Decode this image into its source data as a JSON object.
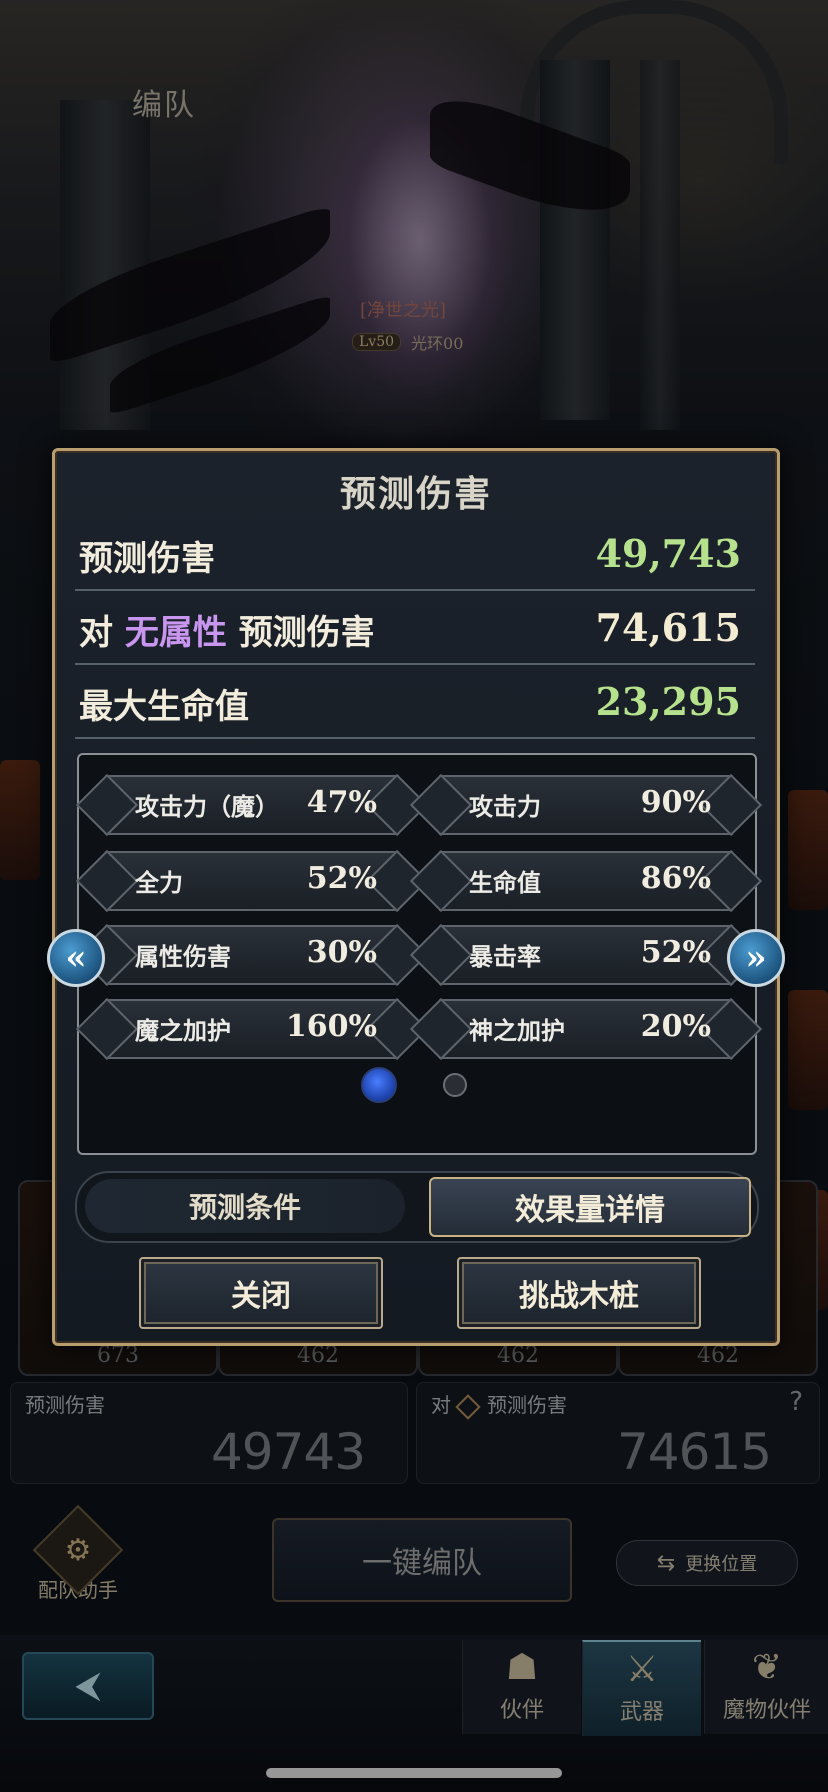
{
  "background": {
    "screen_title": "编队",
    "weapon_name": "[净世之光]",
    "weapon_level": "Lv50",
    "weapon_aura": "光环00",
    "card_counts": [
      "673",
      "462",
      "462",
      "462"
    ],
    "prediction_left": {
      "label": "预测伤害",
      "value": "49743"
    },
    "prediction_right": {
      "label_prefix": "对",
      "label": "预测伤害",
      "value": "74615",
      "help": "?"
    },
    "assist_label": "配队助手",
    "auto_form_label": "一键编队",
    "swap_label": "更换位置",
    "tabs": [
      {
        "label": "伙伴",
        "icon": "partner-icon"
      },
      {
        "label": "武器",
        "icon": "weapon-icon",
        "active": true
      },
      {
        "label": "魔物伙伴",
        "icon": "monster-icon"
      }
    ]
  },
  "dialog": {
    "title": "预测伤害",
    "rows": [
      {
        "label": "预测伤害",
        "value": "49,743",
        "color": "#b7e28d"
      },
      {
        "label_prefix": "对",
        "label_attr": "无属性",
        "label_suffix": "预测伤害",
        "value": "74,615",
        "color": "#f4ecd2"
      },
      {
        "label": "最大生命值",
        "value": "23,295",
        "color": "#b7e28d"
      }
    ],
    "stats": [
      {
        "label": "攻击力（魔）",
        "value": "47%"
      },
      {
        "label": "攻击力",
        "value": "90%"
      },
      {
        "label": "全力",
        "value": "52%"
      },
      {
        "label": "生命值",
        "value": "86%"
      },
      {
        "label": "属性伤害",
        "value": "30%"
      },
      {
        "label": "暴击率",
        "value": "52%"
      },
      {
        "label": "魔之加护",
        "value": "160%"
      },
      {
        "label": "神之加护",
        "value": "20%"
      }
    ],
    "page_indicator": {
      "current": 1,
      "total": 2
    },
    "toggle": {
      "left": "预测条件",
      "right": "效果量详情",
      "selected": "right"
    },
    "buttons": {
      "close": "关闭",
      "challenge": "挑战木桩"
    }
  },
  "colors": {
    "accent_gold": "#b89d6f",
    "value_green": "#b7e28d",
    "attr_purple": "#c996ef",
    "page_active": "#4a7dff"
  }
}
